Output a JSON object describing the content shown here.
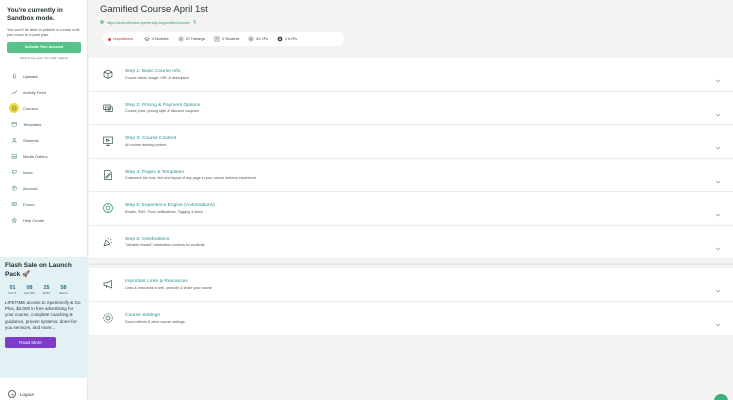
{
  "sidebar": {
    "sandbox_title": "You're currently in Sandbox mode.",
    "sandbox_text": "You won't be able to publish a course until you move to a paid plan.",
    "activate_label": "Activate Your Account",
    "live_note": "Click to see your \"Go LIVE\" options",
    "nav": [
      {
        "label": "Updates",
        "icon": "rocket-icon"
      },
      {
        "label": "Activity Feed",
        "icon": "activity-icon"
      },
      {
        "label": "Courses",
        "icon": "courses-icon",
        "active": true
      },
      {
        "label": "Templates",
        "icon": "templates-icon"
      },
      {
        "label": "Students",
        "icon": "students-icon"
      },
      {
        "label": "Media Gallery",
        "icon": "gallery-icon"
      },
      {
        "label": "Inbox",
        "icon": "inbox-icon"
      },
      {
        "label": "Account",
        "icon": "account-icon"
      },
      {
        "label": "Forum",
        "icon": "forum-icon"
      },
      {
        "label": "Help Center",
        "icon": "help-icon"
      }
    ],
    "promo": {
      "title": "Flash Sale on Launch Pack 🚀",
      "countdown": [
        {
          "value": "01",
          "label": "DAYS"
        },
        {
          "value": "08",
          "label": "HOURS"
        },
        {
          "value": "25",
          "label": "MINS"
        },
        {
          "value": "58",
          "label": "SECS"
        }
      ],
      "text": "LIFETIME access to Xperiencify & Go Plus, $2,000 in free advertising for your course, complete coaching & guidance, proven systems, done-for-you services, and more...",
      "button": "Read More"
    },
    "logout": "Logout"
  },
  "header": {
    "title": "Gamified Course April 1st",
    "url": "https://learnxferkaer.xperiencify.io/gamified-course/",
    "stats": {
      "status": "Unpublished",
      "modules": "4 Modules",
      "trainings": "20 Trainings",
      "students": "0 Students",
      "xps": "63 XPs",
      "kxps": "0 KXPs"
    }
  },
  "steps": [
    {
      "title": "Step 1: Basic Course Info",
      "desc": "Course name, image, URL & description",
      "icon": "box-icon"
    },
    {
      "title": "Step 2: Pricing & Payment Options",
      "desc": "Course price, pricing style & discount coupons",
      "icon": "money-icon"
    },
    {
      "title": "Step 3: Course Content",
      "desc": "All course training content",
      "icon": "monitor-icon"
    },
    {
      "title": "Step 4: Pages & Templates",
      "desc": "Customize the look, feel and layout of any page in your course delivery experience",
      "icon": "edit-page-icon"
    },
    {
      "title": "Step 5: Experience Engine (Automations)",
      "desc": "Emails, SMS, Push notifications, Tagging & More",
      "icon": "engine-icon"
    },
    {
      "title": "Step 6: Celebrations",
      "desc": "\"Variable reward\" celebration screens for students",
      "icon": "confetti-icon"
    }
  ],
  "extras": [
    {
      "title": "Important Links & Resources",
      "desc": "Links & resources to sell, promote & share your course",
      "icon": "megaphone-icon"
    },
    {
      "title": "Course Settings",
      "desc": "Sound effects & other course settings",
      "icon": "settings-icon"
    }
  ],
  "colors": {
    "accent": "#2f8f8f",
    "primary_button": "#59c28b",
    "promo_button": "#7d3cc9",
    "active_nav": "#f1d83c",
    "unpublished": "#e04848"
  }
}
